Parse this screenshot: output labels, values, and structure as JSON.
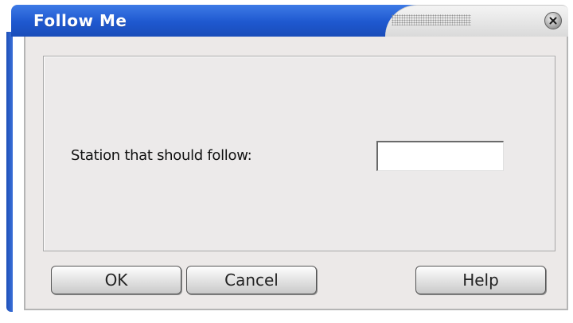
{
  "window": {
    "title": "Follow Me",
    "close_icon": "close-icon"
  },
  "form": {
    "station_label": "Station that should follow:",
    "station_value": "",
    "station_placeholder": ""
  },
  "buttons": {
    "ok_label": "OK",
    "cancel_label": "Cancel",
    "help_label": "Help"
  },
  "colors": {
    "titlebar_blue": "#1e58cf",
    "dialog_background": "#ece9e8"
  }
}
